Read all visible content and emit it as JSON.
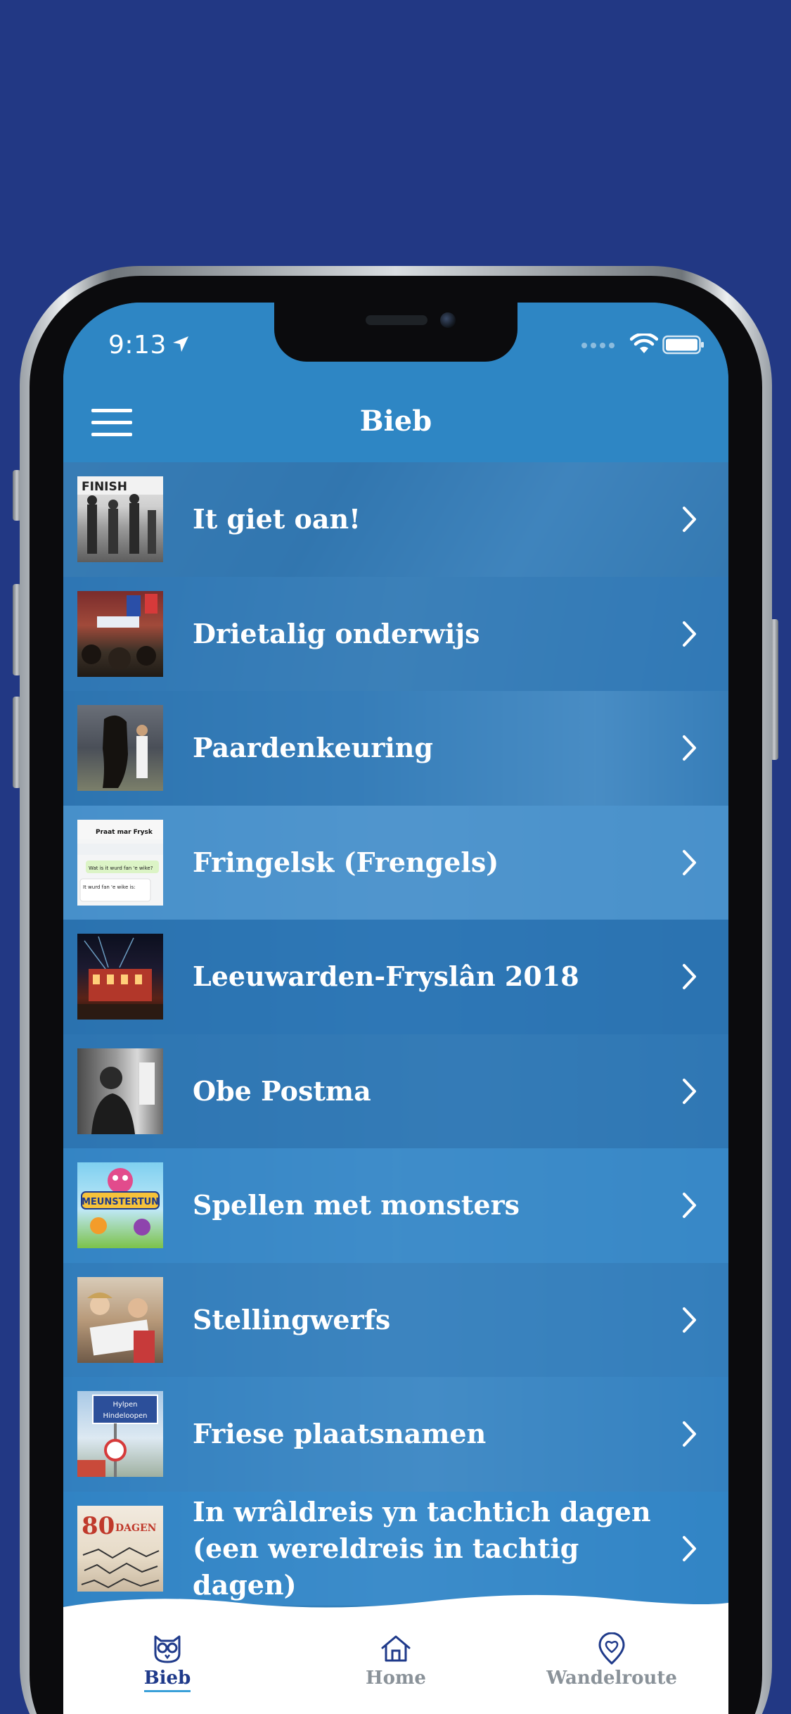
{
  "status": {
    "time": "9:13"
  },
  "nav": {
    "title": "Bieb"
  },
  "items": [
    {
      "label": "It giet oan!",
      "thumb": "finish-icon"
    },
    {
      "label": "Drietalig onderwijs",
      "thumb": "school-sign-icon"
    },
    {
      "label": "Paardenkeuring",
      "thumb": "horse-icon"
    },
    {
      "label": "Fringelsk (Frengels)",
      "thumb": "chat-screenshot-icon"
    },
    {
      "label": "Leeuwarden-Fryslân 2018",
      "thumb": "building-lights-icon"
    },
    {
      "label": "Obe Postma",
      "thumb": "portrait-photo-icon"
    },
    {
      "label": "Spellen met monsters",
      "thumb": "meunstertun-logo-icon"
    },
    {
      "label": "Stellingwerfs",
      "thumb": "children-reading-icon"
    },
    {
      "label": "Friese plaatsnamen",
      "thumb": "town-sign-icon"
    },
    {
      "label": "In wrâldreis yn tachtich dagen\n(een wereldreis in tachtig dagen)",
      "thumb": "book-cover-icon"
    }
  ],
  "thumb_texts": {
    "finish": "FINISH",
    "chat_title": "Praat mar Frysk",
    "chat_msg1": "Wat is it wurd fan 'e wike?",
    "chat_msg2": "It wurd fan 'e wike is:",
    "town_sign_top": "Hylpen",
    "town_sign_bottom": "Hindeloopen",
    "meunstertun": "MEUNSTERTUN",
    "book_number": "80",
    "book_word": "DAGEN"
  },
  "tabs": [
    {
      "label": "Bieb",
      "icon": "owl-icon",
      "active": true
    },
    {
      "label": "Home",
      "icon": "house-icon",
      "active": false
    },
    {
      "label": "Wandelroute",
      "icon": "heart-pin-icon",
      "active": false
    }
  ],
  "colors": {
    "page_bg": "#223884",
    "header_blue": "#2e86c4",
    "row_overlay": "#2e82c4",
    "tab_active": "#1f3a8a",
    "tab_inactive": "#8a9299",
    "tab_underline": "#3aa0d8"
  }
}
